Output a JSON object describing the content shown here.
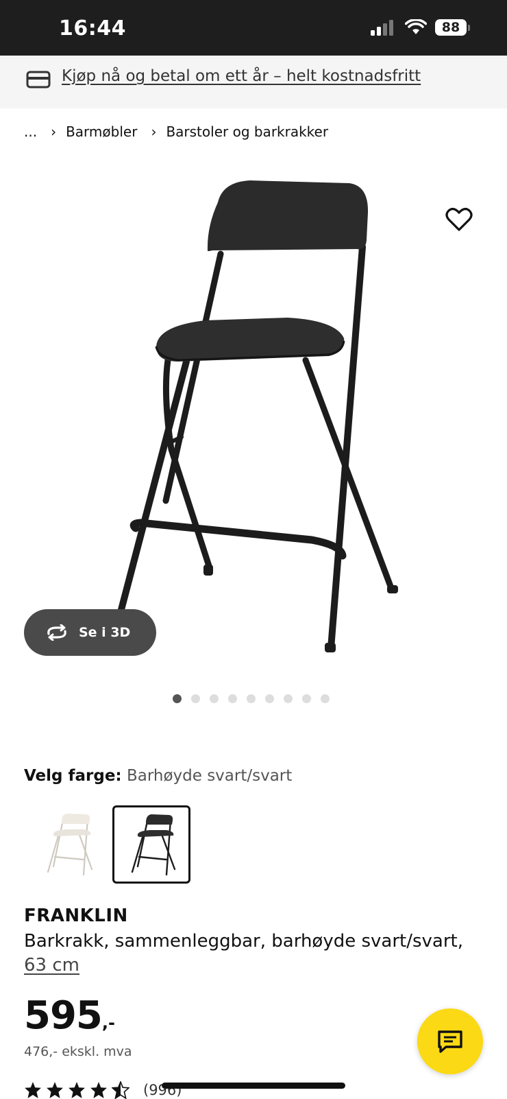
{
  "status_bar": {
    "time": "16:44",
    "battery": "88"
  },
  "promo": {
    "text": "Kjøp nå og betal om ett år – helt kostnadsfritt"
  },
  "breadcrumb": {
    "items": [
      "...",
      "Barmøbler",
      "Barstoler og barkrakker"
    ]
  },
  "gallery": {
    "see_3d_label": "Se i 3D",
    "image_count": 9,
    "active_index": 0
  },
  "color": {
    "label": "Velg farge:",
    "value": "Barhøyde svart/svart",
    "options": [
      "white",
      "black"
    ],
    "selected": "black"
  },
  "product": {
    "name": "FRANKLIN",
    "description": "Barkrakk, sammenleggbar, barhøyde svart/svart,",
    "size": "63 cm",
    "price": "595",
    "price_suffix": ",-",
    "price_ex_vat": "476,- ekskl. mva",
    "rating": 4.5,
    "review_count": "(996)"
  },
  "colors": {
    "accent": "#fbd914",
    "status_bar": "#1e1e1e"
  }
}
